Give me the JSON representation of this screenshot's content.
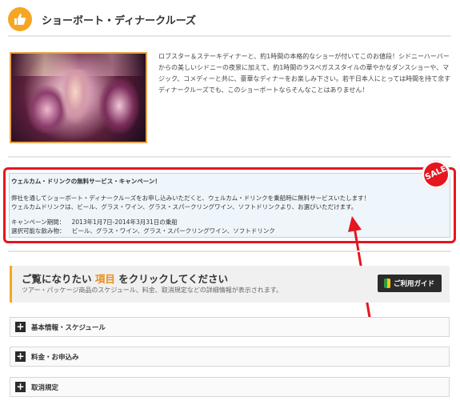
{
  "header": {
    "title": "ショーボート・ディナークルーズ",
    "icon": "thumbs-up-icon",
    "accent": "#f5a623"
  },
  "description": {
    "text": "ロブスター＆ステーキディナーと、約1時間の本格的なショーが付いてこのお値段！シドニーハーバーからの美しいシドニーの夜景に加えて、約1時間のラスベガススタイルの華やかなダンスショーや、マジック、コメディーと共に、豪華なディナーをお楽しみ下さい。若干日本人にとっては時間を持て余すディナークルーズでも、このショーボートならそんなことはありません！"
  },
  "campaign": {
    "title": "ウェルカム・ドリンクの無料サービス・キャンペーン！",
    "line1": "弊社を通してショーボート・ディナークルーズをお申し込みいただくと、ウェルカム・ドリンクを乗船時に無料サービスいたします！",
    "line2": "ウェルカムドリンクは、ビール、グラス・ワイン、グラス・スパークリングワイン、ソフトドリンクより、お選びいただけます。",
    "period_label": "キャンペーン期間：",
    "period_value": "2013年1月7日-2014年3月31日の乗船",
    "drinks_label": "選択可能な飲み物：",
    "drinks_value": "ビール、グラス・ワイン、グラス・スパークリングワイン、ソフトドリンク",
    "badge": "SALE",
    "border_color": "#e5161f"
  },
  "guide": {
    "title_pre": "ご覧になりたい",
    "title_hl": "項目",
    "title_post": "をクリックしてください",
    "subtitle": "ツアー・パッケージ商品のスケジュール、料金、取消規定などの詳細情報が表示されます。",
    "button_label": "ご利用ガイド"
  },
  "accordion": [
    {
      "label": "基本情報・スケジュール",
      "icon": "plus-icon"
    },
    {
      "label": "料金・お申込み",
      "icon": "plus-icon"
    },
    {
      "label": "取消規定",
      "icon": "plus-icon"
    }
  ]
}
